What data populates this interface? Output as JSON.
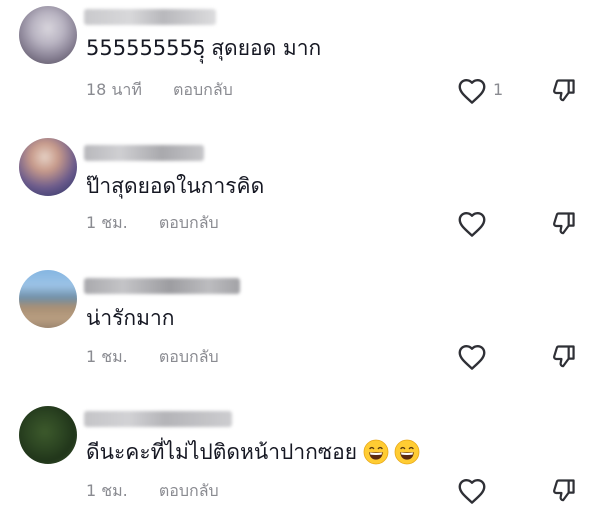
{
  "comments": [
    {
      "text": "555555555ฺุ สุดยอด มาก",
      "time": "18 นาที",
      "reply_label": "ตอบกลับ",
      "like_count": "1",
      "emojis": []
    },
    {
      "text": "ป๊าสุดยอดในการคิด",
      "time": "1 ชม.",
      "reply_label": "ตอบกลับ",
      "like_count": "",
      "emojis": []
    },
    {
      "text": "น่ารักมาก",
      "time": "1 ชม.",
      "reply_label": "ตอบกลับ",
      "like_count": "",
      "emojis": []
    },
    {
      "text": "ดีนะคะที่ไม่ไปติดหน้าปากซอย",
      "time": "1 ชม.",
      "reply_label": "ตอบกลับ",
      "like_count": "",
      "emojis": [
        "grinning-face-with-smiling-eyes",
        "grinning-face-with-smiling-eyes"
      ]
    }
  ],
  "icons": {
    "like": "heart-outline-icon",
    "dislike": "thumbs-down-outline-icon"
  },
  "colors": {
    "text": "#161823",
    "meta": "#8a8b91",
    "icon": "#2f3036"
  }
}
